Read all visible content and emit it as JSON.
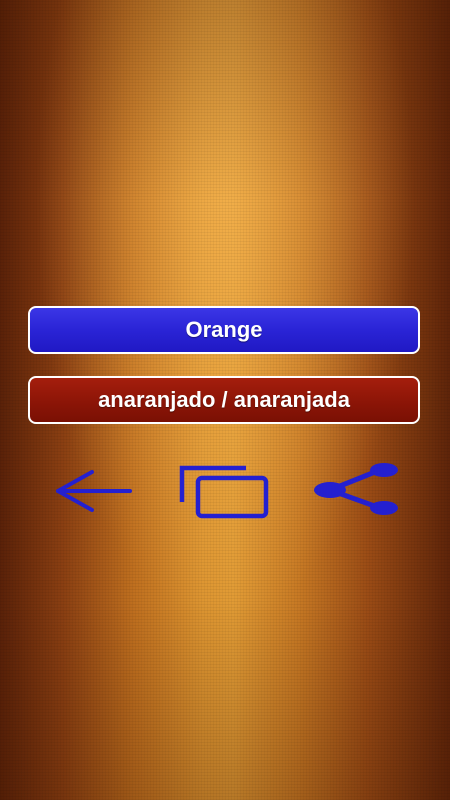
{
  "word": {
    "english": "Orange",
    "spanish": "anaranjado / anaranjada"
  },
  "toolbar": {
    "back_icon": "arrow-left-icon",
    "copy_icon": "copy-icon",
    "share_icon": "share-icon"
  },
  "colors": {
    "word_card": "#2a24d6",
    "translation_card": "#8c1507",
    "icon": "#2420d0",
    "border": "#ffffff"
  }
}
